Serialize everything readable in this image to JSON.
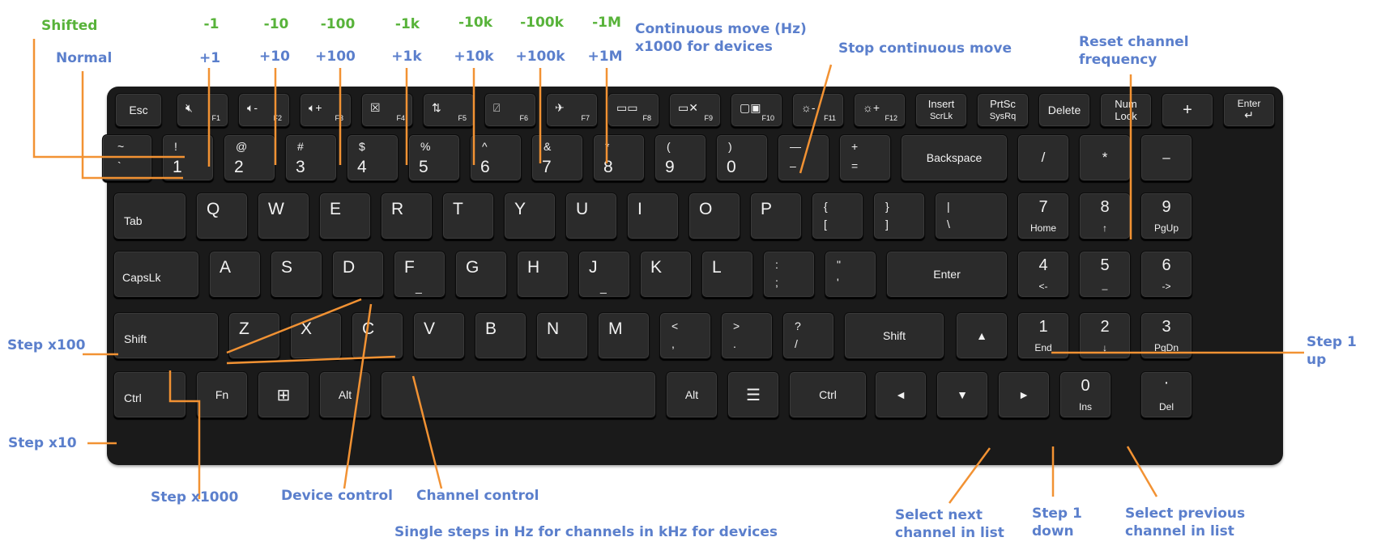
{
  "colors": {
    "label_blue": "#5b7fcc",
    "label_green": "#58b33a",
    "leader_orange": "#f29233",
    "keyboard": "#1a1a1a",
    "key": "#2b2b2b"
  },
  "annotations": {
    "shifted": "Shifted",
    "normal": "Normal",
    "shift_steps": [
      "-1",
      "-10",
      "-100",
      "-1k",
      "-10k",
      "-100k",
      "-1M"
    ],
    "normal_steps": [
      "+1",
      "+10",
      "+100",
      "+1k",
      "+10k",
      "+100k",
      "+1M"
    ],
    "continuous_line1": "Continuous move (Hz)",
    "continuous_line2": "x1000 for devices",
    "stop_continuous": "Stop continuous move",
    "reset_line1": "Reset channel",
    "reset_line2": "frequency",
    "step_x100": "Step x100",
    "step_x10": "Step x10",
    "step_x1000": "Step x1000",
    "device_control": "Device control",
    "channel_control": "Channel control",
    "single_steps": "Single steps in Hz for channels in kHz for devices",
    "step1_up_line1": "Step 1",
    "step1_up_line2": "up",
    "step1_down_line1": "Step 1",
    "step1_down_line2": "down",
    "select_next_line1": "Select next",
    "select_next_line2": "channel in list",
    "select_prev_line1": "Select previous",
    "select_prev_line2": "channel in list"
  },
  "keys": {
    "esc": "Esc",
    "f1": "F1",
    "f2": "F2",
    "f3": "F3",
    "f4": "F4",
    "f5": "F5",
    "f6": "F6",
    "f7": "F7",
    "f8": "F8",
    "f9": "F9",
    "f10": "F10",
    "f11": "F11",
    "f12": "F12",
    "insert": "Insert",
    "scrlk": "ScrLk",
    "prtsc": "PrtSc",
    "sysrq": "SysRq",
    "delete": "Delete",
    "num": "Num",
    "lock": "Lock",
    "kp_plus": "+",
    "enter_top": "Enter",
    "tilde": "~",
    "backtick": "`",
    "n1s": "!",
    "n1": "1",
    "n2s": "@",
    "n2": "2",
    "n3s": "#",
    "n3": "3",
    "n4s": "$",
    "n4": "4",
    "n5s": "%",
    "n5": "5",
    "n6s": "^",
    "n6": "6",
    "n7s": "&",
    "n7": "7",
    "n8s": "*",
    "n8": "8",
    "n9s": "(",
    "n9": "9",
    "n0s": ")",
    "n0": "0",
    "minus_s": "—",
    "minus": "–",
    "plus_s": "+",
    "equals": "=",
    "backspace": "Backspace",
    "kp_slash": "/",
    "kp_star": "*",
    "kp_minus": "–",
    "tab": "Tab",
    "q": "Q",
    "w": "W",
    "e": "E",
    "r": "R",
    "t": "T",
    "y": "Y",
    "u": "U",
    "i": "I",
    "o": "O",
    "p": "P",
    "lbrace": "{",
    "lbracket": "[",
    "rbrace": "}",
    "rbracket": "]",
    "pipe": "|",
    "backslash": "\\",
    "kp7": "7",
    "home": "Home",
    "kp8": "8",
    "up_small": "↑",
    "kp9": "9",
    "pgup": "PgUp",
    "capslk": "CapsLk",
    "a": "A",
    "s": "S",
    "d": "D",
    "f": "F",
    "g": "G",
    "h": "H",
    "j": "J",
    "k": "K",
    "l": "L",
    "colon": ":",
    "semicolon": ";",
    "quote": "\"",
    "apos": "'",
    "enter": "Enter",
    "kp4": "4",
    "left_small": "<-",
    "kp5": "5",
    "kp6": "6",
    "right_small": "->",
    "shift": "Shift",
    "z": "Z",
    "x": "X",
    "c": "C",
    "v": "V",
    "b": "B",
    "n": "N",
    "m": "M",
    "lt": "<",
    "comma": ",",
    "gt": ">",
    "period": ".",
    "question": "?",
    "slash": "/",
    "rshift": "Shift",
    "arrow_up": "▲",
    "kp1": "1",
    "end": "End",
    "kp2": "2",
    "down_small": "↓",
    "kp3": "3",
    "pgdn": "PgDn",
    "ctrl": "Ctrl",
    "fn": "Fn",
    "alt": "Alt",
    "ralt": "Alt",
    "rctrl": "Ctrl",
    "arrow_left": "◄",
    "arrow_down": "▼",
    "arrow_right": "►",
    "kp0": "0",
    "ins": "Ins",
    "kp_dot": "·",
    "del": "Del"
  }
}
